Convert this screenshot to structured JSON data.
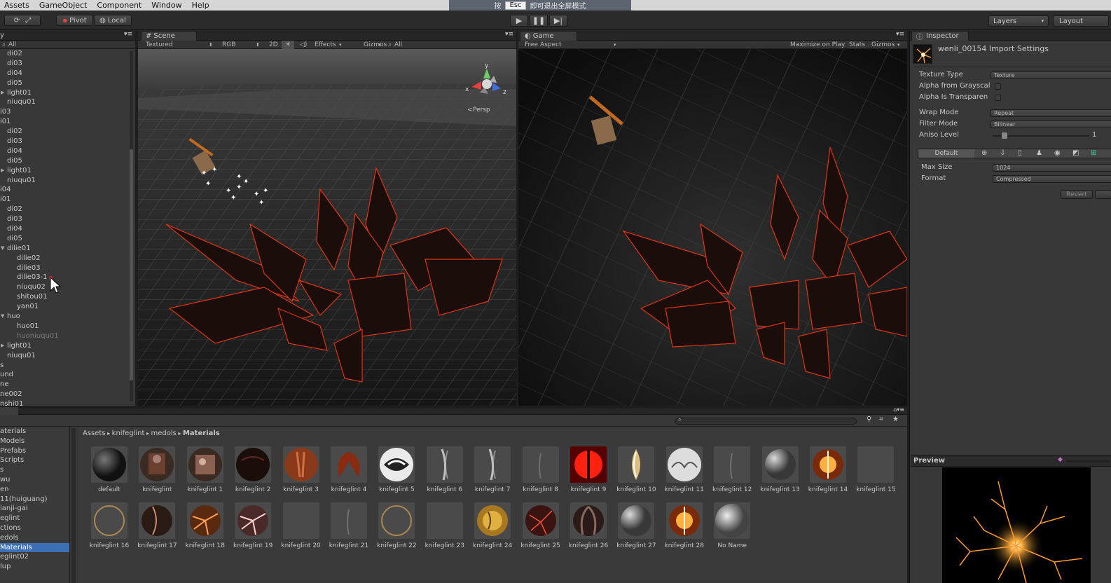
{
  "menu": [
    "Assets",
    "GameObject",
    "Component",
    "Window",
    "Help"
  ],
  "overlay": {
    "left": "按",
    "box": "Esc",
    "right": "即可退出全屏模式"
  },
  "toolbar": {
    "pivot": "Pivot",
    "local": "Local",
    "layers": "Layers",
    "layout": "Layout"
  },
  "hierarchy": {
    "tab": "y",
    "search": "All",
    "items": [
      {
        "label": "di02",
        "indent": 1,
        "arrow": ""
      },
      {
        "label": "di03",
        "indent": 1,
        "arrow": ""
      },
      {
        "label": "di04",
        "indent": 1,
        "arrow": ""
      },
      {
        "label": "di05",
        "indent": 1,
        "arrow": ""
      },
      {
        "label": "light01",
        "indent": 1,
        "arrow": "right"
      },
      {
        "label": "niuqu01",
        "indent": 1,
        "arrow": ""
      },
      {
        "label": "i03",
        "indent": 0,
        "arrow": ""
      },
      {
        "label": "i01",
        "indent": 0,
        "arrow": ""
      },
      {
        "label": "di02",
        "indent": 1,
        "arrow": ""
      },
      {
        "label": "di03",
        "indent": 1,
        "arrow": ""
      },
      {
        "label": "di04",
        "indent": 1,
        "arrow": ""
      },
      {
        "label": "di05",
        "indent": 1,
        "arrow": ""
      },
      {
        "label": "light01",
        "indent": 1,
        "arrow": "right"
      },
      {
        "label": "niuqu01",
        "indent": 1,
        "arrow": ""
      },
      {
        "label": "i04",
        "indent": 0,
        "arrow": ""
      },
      {
        "label": "i01",
        "indent": 0,
        "arrow": ""
      },
      {
        "label": "di02",
        "indent": 1,
        "arrow": ""
      },
      {
        "label": "di03",
        "indent": 1,
        "arrow": ""
      },
      {
        "label": "di04",
        "indent": 1,
        "arrow": ""
      },
      {
        "label": "di05",
        "indent": 1,
        "arrow": ""
      },
      {
        "label": "dilie01",
        "indent": 1,
        "arrow": "down"
      },
      {
        "label": "dilie02",
        "indent": 2,
        "arrow": ""
      },
      {
        "label": "dilie03",
        "indent": 2,
        "arrow": ""
      },
      {
        "label": "dilie03-1",
        "indent": 2,
        "arrow": ""
      },
      {
        "label": "niuqu02",
        "indent": 2,
        "arrow": ""
      },
      {
        "label": "shitou01",
        "indent": 2,
        "arrow": ""
      },
      {
        "label": "yan01",
        "indent": 2,
        "arrow": ""
      },
      {
        "label": "huo",
        "indent": 1,
        "arrow": "down"
      },
      {
        "label": "huo01",
        "indent": 2,
        "arrow": ""
      },
      {
        "label": "huoniuqu01",
        "indent": 2,
        "arrow": "",
        "dim": true
      },
      {
        "label": "light01",
        "indent": 1,
        "arrow": "right"
      },
      {
        "label": "niuqu01",
        "indent": 1,
        "arrow": ""
      },
      {
        "label": "s",
        "indent": 0,
        "arrow": ""
      },
      {
        "label": "und",
        "indent": 0,
        "arrow": ""
      },
      {
        "label": "ne",
        "indent": 0,
        "arrow": ""
      },
      {
        "label": "ne002",
        "indent": 0,
        "arrow": ""
      },
      {
        "label": "nshi01",
        "indent": 0,
        "arrow": ""
      }
    ]
  },
  "scene": {
    "tab": "Scene",
    "shading": "Textured",
    "rgb": "RGB",
    "mode2d": "2D",
    "effects": "Effects",
    "gizmos": "Gizmos",
    "search": "All",
    "persp": "Persp",
    "axis_y": "y",
    "axis_x": "x",
    "axis_z": "z"
  },
  "game": {
    "tab": "Game",
    "aspect": "Free Aspect",
    "maximize": "Maximize on Play",
    "stats": "Stats",
    "gizmos": "Gizmos"
  },
  "inspector": {
    "tab": "Inspector",
    "title": "wenli_00154 Import Settings",
    "rows": [
      {
        "label": "Texture Type",
        "value": "Texture",
        "kind": "dropdown"
      },
      {
        "label": "Alpha from Grayscal",
        "value": "",
        "kind": "check"
      },
      {
        "label": "Alpha Is Transparen",
        "value": "",
        "kind": "check"
      },
      {
        "label": "Wrap Mode",
        "value": "Repeat",
        "kind": "dropdown"
      },
      {
        "label": "Filter Mode",
        "value": "Bilinear",
        "kind": "dropdown"
      },
      {
        "label": "Aniso Level",
        "value": "1",
        "kind": "slider"
      }
    ],
    "platform_default": "Default",
    "max_size_label": "Max Size",
    "max_size": "1024",
    "format_label": "Format",
    "format": "Compressed",
    "revert": "Revert",
    "preview": "Preview"
  },
  "project": {
    "left_items": [
      {
        "label": "aterials",
        "sel": false
      },
      {
        "label": "Models",
        "sel": false
      },
      {
        "label": "Prefabs",
        "sel": false
      },
      {
        "label": "Scripts",
        "sel": false
      },
      {
        "label": "s",
        "sel": false
      },
      {
        "label": "wu",
        "sel": false
      },
      {
        "label": "en",
        "sel": false
      },
      {
        "label": "11(huiguang)",
        "sel": false
      },
      {
        "label": "ianji-gai",
        "sel": false
      },
      {
        "label": "eglint",
        "sel": false
      },
      {
        "label": "ctions",
        "sel": false
      },
      {
        "label": "edols",
        "sel": false
      },
      {
        "label": " Materials",
        "sel": true
      },
      {
        "label": "eglint02",
        "sel": false
      },
      {
        "label": "lup",
        "sel": false
      }
    ],
    "breadcrumb": [
      "Assets",
      "knifeglint",
      "medols",
      "Materials"
    ],
    "assets_row1": [
      {
        "name": "default",
        "style": "sphere"
      },
      {
        "name": "knifeglint",
        "style": "char"
      },
      {
        "name": "knifeglint 1",
        "style": "char2"
      },
      {
        "name": "knifeglint 2",
        "style": "dark"
      },
      {
        "name": "knifeglint 3",
        "style": "orange"
      },
      {
        "name": "knifeglint 4",
        "style": "wings"
      },
      {
        "name": "knifeglint 5",
        "style": "white"
      },
      {
        "name": "knifeglint 6",
        "style": "streak"
      },
      {
        "name": "knifeglint 7",
        "style": "streak"
      },
      {
        "name": "knifeglint 8",
        "style": "faint"
      },
      {
        "name": "knifeglint 9",
        "style": "red"
      },
      {
        "name": "knifeglint 10",
        "style": "gold"
      },
      {
        "name": "knifeglint 11",
        "style": "whitecloud"
      },
      {
        "name": "knifeglint 12",
        "style": "faint"
      },
      {
        "name": "knifeglint 13",
        "style": "glass"
      },
      {
        "name": "knifeglint 14",
        "style": "fire"
      },
      {
        "name": "knifeglint 15",
        "style": "empty"
      }
    ],
    "assets_row2": [
      {
        "name": "knifeglint 16",
        "style": "ring"
      },
      {
        "name": "knifeglint 17",
        "style": "darkring"
      },
      {
        "name": "knifeglint 18",
        "style": "orangecrack"
      },
      {
        "name": "knifeglint 19",
        "style": "pinkcrack"
      },
      {
        "name": "knifeglint 20",
        "style": "empty"
      },
      {
        "name": "knifeglint 21",
        "style": "faint"
      },
      {
        "name": "knifeglint 22",
        "style": "ring"
      },
      {
        "name": "knifeglint 23",
        "style": "empty"
      },
      {
        "name": "knifeglint 24",
        "style": "goldball"
      },
      {
        "name": "knifeglint 25",
        "style": "redcrack"
      },
      {
        "name": "knifeglint 26",
        "style": "darkwings"
      },
      {
        "name": "knifeglint 27",
        "style": "glass"
      },
      {
        "name": "knifeglint 28",
        "style": "fire"
      },
      {
        "name": "No Name",
        "style": "graysphere"
      }
    ]
  },
  "colors": {
    "accent": "#3d6fb6",
    "lava": "#ff3a10",
    "panel": "#383838"
  }
}
